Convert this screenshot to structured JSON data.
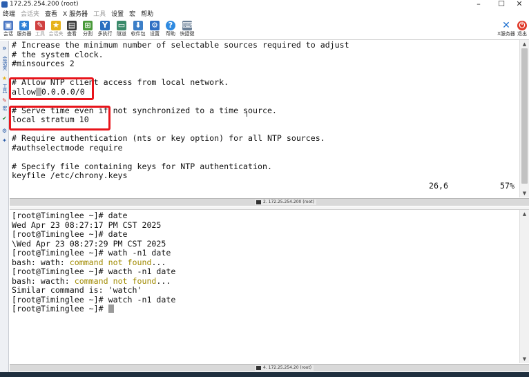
{
  "window": {
    "title": "172.25.254.200 (root)",
    "minimize": "–",
    "maximize": "☐",
    "close": "✕"
  },
  "menu": [
    {
      "label": "终端",
      "enabled": true
    },
    {
      "label": "会话夹",
      "enabled": false
    },
    {
      "label": "查看",
      "enabled": true
    },
    {
      "label": "X 服务器",
      "enabled": true
    },
    {
      "label": "工具",
      "enabled": false
    },
    {
      "label": "设置",
      "enabled": true
    },
    {
      "label": "宏",
      "enabled": true
    },
    {
      "label": "帮助",
      "enabled": true
    }
  ],
  "toolbar": {
    "items": [
      {
        "label": "会话",
        "icon": "session-icon",
        "color": "#4a77c4",
        "glyph": "▣"
      },
      {
        "label": "服务器",
        "icon": "servers-icon",
        "color": "#2f7fd6",
        "glyph": "✱"
      },
      {
        "label": "工具",
        "icon": "tools-icon",
        "color": "#d04040",
        "glyph": "✎"
      },
      {
        "label": "会话夹",
        "icon": "star-icon",
        "color": "#e6b21a",
        "glyph": "★"
      },
      {
        "label": "查看",
        "icon": "view-icon",
        "color": "#3a3a3a",
        "glyph": "▤"
      },
      {
        "label": "分割",
        "icon": "split-icon",
        "color": "#4a9a3a",
        "glyph": "⊞"
      },
      {
        "label": "多执行",
        "icon": "multiexec-icon",
        "color": "#2a6fc0",
        "glyph": "Y"
      },
      {
        "label": "隧道",
        "icon": "tunnel-icon",
        "color": "#3a8a6a",
        "glyph": "▭"
      },
      {
        "label": "软件包",
        "icon": "packages-icon",
        "color": "#3c7fc8",
        "glyph": "⬇"
      },
      {
        "label": "设置",
        "icon": "settings-icon",
        "color": "#2f6fc4",
        "glyph": "⚙"
      },
      {
        "label": "帮助",
        "icon": "help-icon",
        "color": "#2f8ae0",
        "glyph": "?"
      },
      {
        "label": "快捷键",
        "icon": "keyboard-icon",
        "color": "#6a7f96",
        "glyph": "⌨"
      }
    ],
    "xserver_label": "X服务器",
    "exit_label": "退出"
  },
  "sidebar": {
    "items": [
      "»",
      "会话夹",
      "★",
      "工具",
      "✎",
      "宏",
      "✔",
      "⚙",
      "✦"
    ]
  },
  "terminal_top": {
    "lines": [
      "# Increase the minimum number of selectable sources required to adjust",
      "# the system clock.",
      "#minsources 2",
      "",
      "# Allow NTP client access from local network.",
      "allow 0.0.0.0/0",
      "",
      "# Serve time even if not synchronized to a time source.",
      "local stratum 10",
      "",
      "# Require authentication (nts or key option) for all NTP sources.",
      "#authselectmode require",
      "",
      "# Specify file containing keys for NTP authentication.",
      "keyfile /etc/chrony.keys"
    ],
    "allow_prefix": "allow",
    "allow_suffix": "0.0.0.0/0",
    "position": "26,6",
    "percent": "57%",
    "pane_label": "2. 172.25.254.200 (root)"
  },
  "terminal_bottom": {
    "lines": [
      {
        "text": "[root@Timinglee ~]# date"
      },
      {
        "text": "Wed Apr 23 08:27:17 PM CST 2025"
      },
      {
        "text": "[root@Timinglee ~]# date"
      },
      {
        "text": "\\Wed Apr 23 08:27:29 PM CST 2025"
      },
      {
        "text": "[root@Timinglee ~]# wath -n1 date"
      },
      {
        "pre": "bash: wath: ",
        "hl": "command not found",
        "post": "..."
      },
      {
        "text": "[root@Timinglee ~]# wacth -n1 date"
      },
      {
        "pre": "bash: wacth: ",
        "hl": "command not found",
        "post": "..."
      },
      {
        "text": "Similar command is: 'watch'"
      },
      {
        "text": "[root@Timinglee ~]# watch -n1 date"
      },
      {
        "text": "[root@Timinglee ~]# "
      }
    ],
    "pane_label": "4. 172.25.254.20 (root)"
  }
}
